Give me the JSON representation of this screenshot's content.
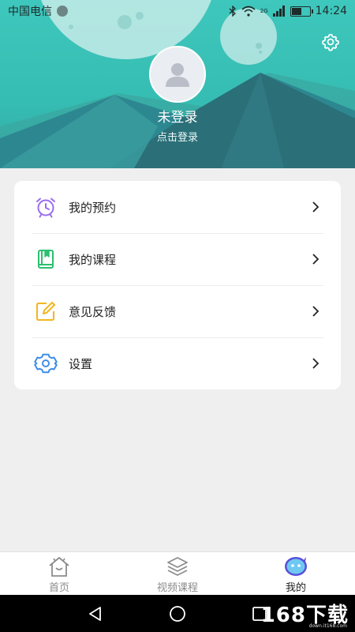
{
  "status_bar": {
    "carrier": "中国电信",
    "signal_type": "2G",
    "time": "14:24",
    "battery_level": 0.6
  },
  "profile": {
    "login_status": "未登录",
    "login_hint": "点击登录"
  },
  "menu": {
    "items": [
      {
        "label": "我的预约",
        "icon": "alarm-clock-icon",
        "color": "#9b6cf2"
      },
      {
        "label": "我的课程",
        "icon": "book-icon",
        "color": "#2bbf6e"
      },
      {
        "label": "意见反馈",
        "icon": "edit-icon",
        "color": "#f2b61f"
      },
      {
        "label": "设置",
        "icon": "gear-icon",
        "color": "#3f8ee8"
      }
    ]
  },
  "bottom_nav": {
    "items": [
      {
        "label": "首页",
        "icon": "home-icon",
        "active": false
      },
      {
        "label": "视频课程",
        "icon": "layers-icon",
        "active": false
      },
      {
        "label": "我的",
        "icon": "chat-bubble-face-icon",
        "active": true
      }
    ]
  },
  "watermark": {
    "main": "168下载",
    "sub": "down.it168.com"
  },
  "colors": {
    "header_teal": "#3ec7bc",
    "mountain_dark": "#2b6f78",
    "accent_blue": "#3f8ee8"
  }
}
